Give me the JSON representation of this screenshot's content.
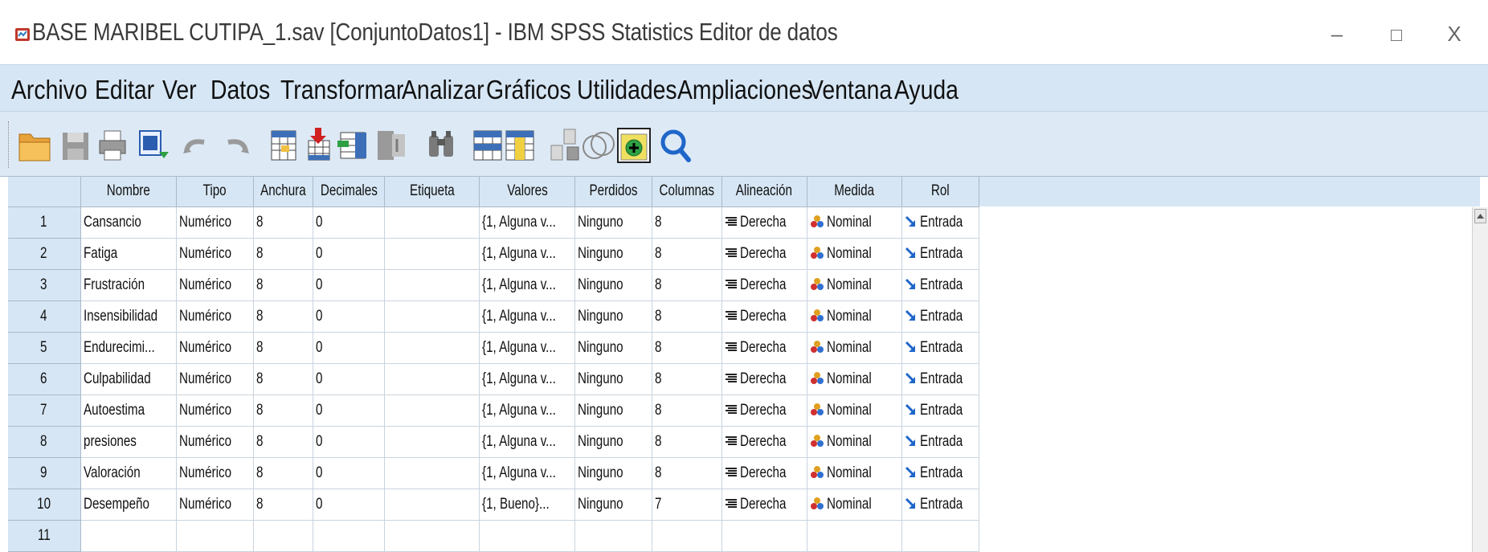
{
  "window": {
    "title": "BASE MARIBEL CUTIPA_1.sav [ConjuntoDatos1] - IBM SPSS Statistics Editor de datos",
    "minimize": "–",
    "close": "X"
  },
  "menu": [
    {
      "label": "Archivo"
    },
    {
      "label": "Editar"
    },
    {
      "label": "Ver"
    },
    {
      "label": "Datos"
    },
    {
      "label": "Transformar"
    },
    {
      "label": "Analizar"
    },
    {
      "label": "Gráficos"
    },
    {
      "label": "Utilidades"
    },
    {
      "label": "Ampliaciones"
    },
    {
      "label": "Ventana"
    },
    {
      "label": "Ayuda"
    }
  ],
  "toolbar": {
    "icons": [
      "open-icon",
      "save-icon",
      "print-icon",
      "dialog-recall-icon",
      "undo-icon",
      "redo-icon",
      "goto-case-icon",
      "goto-variable-icon",
      "variables-icon",
      "run-descriptives-icon",
      "find-icon",
      "insert-cases-icon",
      "insert-variable-icon",
      "split-file-icon",
      "select-cases-icon",
      "value-labels-icon",
      "search-icon"
    ]
  },
  "grid": {
    "columns": [
      "Nombre",
      "Tipo",
      "Anchura",
      "Decimales",
      "Etiqueta",
      "Valores",
      "Perdidos",
      "Columnas",
      "Alineación",
      "Medida",
      "Rol"
    ],
    "rows": [
      {
        "num": "1",
        "nombre": "Cansancio",
        "tipo": "Numérico",
        "anchura": "8",
        "decimales": "0",
        "etiqueta": "",
        "valores": "{1, Alguna v...",
        "perdidos": "Ninguno",
        "columnas": "8",
        "alineacion": "Derecha",
        "medida": "Nominal",
        "rol": "Entrada"
      },
      {
        "num": "2",
        "nombre": "Fatiga",
        "tipo": "Numérico",
        "anchura": "8",
        "decimales": "0",
        "etiqueta": "",
        "valores": "{1, Alguna v...",
        "perdidos": "Ninguno",
        "columnas": "8",
        "alineacion": "Derecha",
        "medida": "Nominal",
        "rol": "Entrada"
      },
      {
        "num": "3",
        "nombre": "Frustración",
        "tipo": "Numérico",
        "anchura": "8",
        "decimales": "0",
        "etiqueta": "",
        "valores": "{1, Alguna v...",
        "perdidos": "Ninguno",
        "columnas": "8",
        "alineacion": "Derecha",
        "medida": "Nominal",
        "rol": "Entrada"
      },
      {
        "num": "4",
        "nombre": "Insensibilidad",
        "tipo": "Numérico",
        "anchura": "8",
        "decimales": "0",
        "etiqueta": "",
        "valores": "{1, Alguna v...",
        "perdidos": "Ninguno",
        "columnas": "8",
        "alineacion": "Derecha",
        "medida": "Nominal",
        "rol": "Entrada"
      },
      {
        "num": "5",
        "nombre": "Endurecimi...",
        "tipo": "Numérico",
        "anchura": "8",
        "decimales": "0",
        "etiqueta": "",
        "valores": "{1, Alguna v...",
        "perdidos": "Ninguno",
        "columnas": "8",
        "alineacion": "Derecha",
        "medida": "Nominal",
        "rol": "Entrada"
      },
      {
        "num": "6",
        "nombre": "Culpabilidad",
        "tipo": "Numérico",
        "anchura": "8",
        "decimales": "0",
        "etiqueta": "",
        "valores": "{1, Alguna v...",
        "perdidos": "Ninguno",
        "columnas": "8",
        "alineacion": "Derecha",
        "medida": "Nominal",
        "rol": "Entrada"
      },
      {
        "num": "7",
        "nombre": "Autoestima",
        "tipo": "Numérico",
        "anchura": "8",
        "decimales": "0",
        "etiqueta": "",
        "valores": "{1, Alguna v...",
        "perdidos": "Ninguno",
        "columnas": "8",
        "alineacion": "Derecha",
        "medida": "Nominal",
        "rol": "Entrada"
      },
      {
        "num": "8",
        "nombre": "presiones",
        "tipo": "Numérico",
        "anchura": "8",
        "decimales": "0",
        "etiqueta": "",
        "valores": "{1, Alguna v...",
        "perdidos": "Ninguno",
        "columnas": "8",
        "alineacion": "Derecha",
        "medida": "Nominal",
        "rol": "Entrada"
      },
      {
        "num": "9",
        "nombre": "Valoración",
        "tipo": "Numérico",
        "anchura": "8",
        "decimales": "0",
        "etiqueta": "",
        "valores": "{1, Alguna v...",
        "perdidos": "Ninguno",
        "columnas": "8",
        "alineacion": "Derecha",
        "medida": "Nominal",
        "rol": "Entrada"
      },
      {
        "num": "10",
        "nombre": "Desempeño",
        "tipo": "Numérico",
        "anchura": "8",
        "decimales": "0",
        "etiqueta": "",
        "valores": "{1, Bueno}...",
        "perdidos": "Ninguno",
        "columnas": "7",
        "alineacion": "Derecha",
        "medida": "Nominal",
        "rol": "Entrada"
      },
      {
        "num": "11",
        "nombre": "",
        "tipo": "",
        "anchura": "",
        "decimales": "",
        "etiqueta": "",
        "valores": "",
        "perdidos": "",
        "columnas": "",
        "alineacion": "",
        "medida": "",
        "rol": ""
      }
    ]
  },
  "colors": {
    "menu_bg": "#d6e6f4",
    "header_bg": "#d6e6f4",
    "grid_line": "#c9d4df",
    "rol_arrow": "#1f66c9"
  }
}
